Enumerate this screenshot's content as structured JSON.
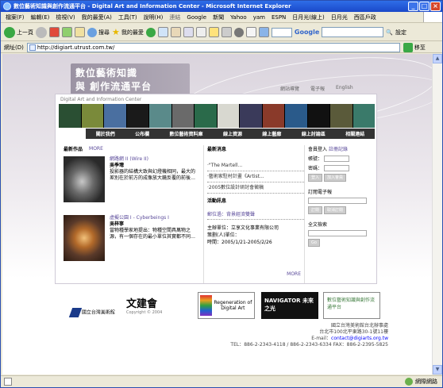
{
  "window": {
    "title": "數位藝術知識與創作流通平台 - Digital Art and Information Center - Microsoft Internet Explorer"
  },
  "menu": [
    "檔案(F)",
    "編輯(E)",
    "檢視(V)",
    "我的最愛(A)",
    "工具(T)",
    "說明(H)"
  ],
  "links_bar": {
    "label": "連結",
    "items": [
      "Google",
      "新聞",
      "Yahoo",
      "yam",
      "ESPN",
      "日月光(線上)",
      "日月光",
      "西區戶政"
    ]
  },
  "toolbar": {
    "back": "上一頁",
    "search": "搜尋",
    "favorites": "我的最愛",
    "google_label": "Google",
    "settings": "設定"
  },
  "address": {
    "label": "網址(D)",
    "url": "http://digiart.utrust.com.tw/",
    "go": "移至"
  },
  "status": {
    "zone": "網際網路"
  },
  "site": {
    "brand_line1": "數位藝術知識",
    "brand_line2": "與 創作流通平台",
    "panel_title": "Digital Art and Information Center",
    "toplinks": [
      "網站導覽",
      "電子報",
      "English"
    ],
    "nav": [
      "關於我們",
      "公布欄",
      "數位藝術資料庫",
      "線上資源",
      "線上藝廊",
      "線上討論區",
      "相關連結"
    ],
    "new_works": {
      "title": "最新作品",
      "more": "MORE"
    },
    "works": [
      {
        "title": "網路網 II (Wire II)",
        "author": "吳季璁",
        "desc": "投影器的結構大致與幻燈機相同，最大的差別在於前方的成像放大鏡反覆的前後…"
      },
      {
        "title": "虛擬公園 I - Cyberbeings I",
        "author": "吳梓寧",
        "desc": "當物種學家地提出：物種空間具萬物之源，有一個存在的最小單位其實都不同…"
      }
    ],
    "news": {
      "title": "最新消息",
      "items": [
        "‧\"The Martell...",
        "‧藝術家駐村計畫《Artist...",
        "‧2005數位設計研討會徵稿"
      ]
    },
    "activity": {
      "title": "活動訊息",
      "head": "郵位過：背景經濟雙聲",
      "lines": [
        "主辦單位：立享文化事業有限公司",
        "策劃(人)單位：",
        "時間：2005/1/21-2005/2/26"
      ],
      "more": "MORE"
    },
    "member": {
      "title": "會員登入",
      "register": "註冊記錄",
      "account": "帳號：",
      "password": "密碼：",
      "login": "登入",
      "join": "加入會員"
    },
    "newsletter": {
      "title": "訂閱電子報",
      "subscribe": "訂閱",
      "unsubscribe": "取消訂閱"
    },
    "search": {
      "title": "全文檢索",
      "go": "Go"
    },
    "logos": [
      "國立台灣美術館",
      "文建會",
      "Copyright © 2004",
      "Regeneration of Digital Art",
      "NAVIGATOR 未來之光",
      "數位藝術知識與創作流通平台"
    ],
    "footer": {
      "org": "國立台灣美術館台北辦事處",
      "addr": "台北市100北平東路30-1號11樓",
      "email_label": "E-mail：",
      "email": "contact@digiarts.org.tw",
      "tel": "TEL：886-2-2343-4118 / 886-2-2343-6334     FAX：886-2-2395-5825"
    }
  },
  "colors": {
    "title_bar": "#1a48c9",
    "nav_bg": "#333333",
    "accent_link": "#5a4a9a"
  }
}
